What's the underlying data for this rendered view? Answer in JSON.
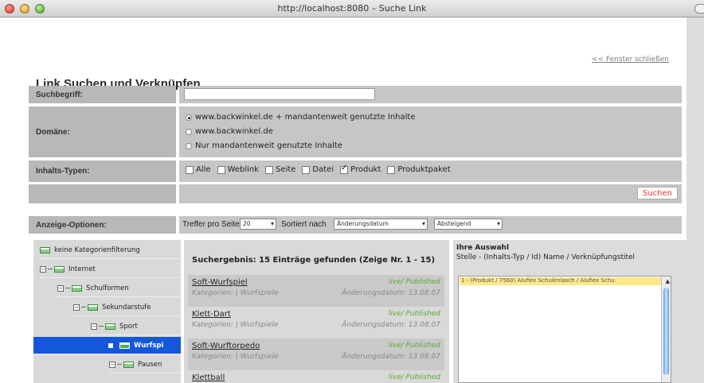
{
  "window": {
    "title": "http://localhost:8080 – Suche Link"
  },
  "header": {
    "title": "Link Suchen und Verknüpfen",
    "close_link": "<< Fenster schließen"
  },
  "form": {
    "search_label": "Suchbegriff:",
    "search_value": "",
    "domain_label": "Domäne:",
    "domain_options": [
      {
        "label": "www.backwinkel.de + mandantenweit genutzte Inhalte",
        "selected": true
      },
      {
        "label": "www.backwinkel.de",
        "selected": false
      },
      {
        "label": "Nur mandantenweit genutzte Inhalte",
        "selected": false
      }
    ],
    "types_label": "Inhalts-Typen:",
    "types": [
      {
        "label": "Alle",
        "checked": false
      },
      {
        "label": "Weblink",
        "checked": false
      },
      {
        "label": "Seite",
        "checked": false
      },
      {
        "label": "Datei",
        "checked": false
      },
      {
        "label": "Produkt",
        "checked": true
      },
      {
        "label": "Produktpaket",
        "checked": false
      }
    ],
    "search_button": "Suchen"
  },
  "options": {
    "label": "Anzeige-Optionen:",
    "per_page_label": "Treffer pro Seite",
    "per_page_value": "20",
    "sort_label": "Sortiert nach",
    "sort_value": "Änderungsdatum",
    "order_value": "Absteigend"
  },
  "tree": {
    "nodes": [
      {
        "label": "keine Kategorienfilterung"
      },
      {
        "label": "Internet"
      },
      {
        "label": "Schulformen"
      },
      {
        "label": "Sekundarstufe"
      },
      {
        "label": "Sport"
      },
      {
        "label": "Wurfspi"
      },
      {
        "label": "Pausen"
      }
    ]
  },
  "results": {
    "heading": "Suchergebnis:  15 Einträge gefunden (Zeige Nr. 1 - 15)",
    "items": [
      {
        "name": "Soft-Wurfspiel",
        "status": "live/ Published",
        "category": "Kategorien: | Wurfspiele",
        "date": "Änderungsdatum: 13.08.07"
      },
      {
        "name": "Klett-Dart",
        "status": "live/ Published",
        "category": "Kategorien: | Wurfspiele",
        "date": "Änderungsdatum: 13.08.07"
      },
      {
        "name": "Soft-Wurftorpedo",
        "status": "live/ Published",
        "category": "Kategorien: | Wurfspiele",
        "date": "Änderungsdatum: 13.08.07"
      },
      {
        "name": "Klettball",
        "status": "live/ Published",
        "category": "",
        "date": ""
      }
    ]
  },
  "selection": {
    "title": "Ihre Auswahl",
    "subtitle": "Stelle - (Inhalts-Typ / Id) Name / Verknüpfungstitel",
    "items": [
      {
        "label": "1 - (Produkt / 7560) Alufiex Schulenlasch / Alufiex Schu"
      }
    ]
  }
}
